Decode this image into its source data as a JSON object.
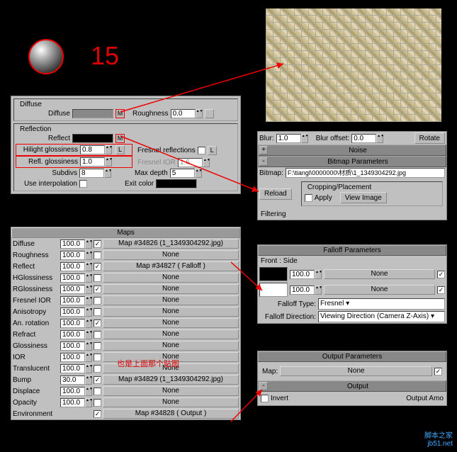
{
  "number": "15",
  "diffuse_panel": {
    "title": "Diffuse",
    "diffuse_lbl": "Diffuse",
    "roughness_lbl": "Roughness",
    "roughness_val": "0.0",
    "m": "M"
  },
  "reflection_panel": {
    "title": "Reflection",
    "reflect_lbl": "Reflect",
    "m": "M",
    "hilight_lbl": "Hilight glossiness",
    "hilight_val": "0.8",
    "l": "L",
    "refl_gloss_lbl": "Refl. glossiness",
    "refl_gloss_val": "1.0",
    "fresnel_refl_lbl": "Fresnel reflections",
    "fresnel_ior_lbl": "Fresnel IOR",
    "fresnel_ior_val": "1.6",
    "subdivs_lbl": "Subdivs",
    "subdivs_val": "8",
    "maxdepth_lbl": "Max depth",
    "maxdepth_val": "5",
    "interp_lbl": "Use interpolation",
    "exit_lbl": "Exit color"
  },
  "maps": {
    "title": "Maps",
    "rows": [
      {
        "label": "Diffuse",
        "amt": "100.0",
        "chk": true,
        "slot": "Map #34826 (1_1349304292.jpg)",
        "red": true
      },
      {
        "label": "Roughness",
        "amt": "100.0",
        "chk": false,
        "slot": "None"
      },
      {
        "label": "Reflect",
        "amt": "100.0",
        "chk": true,
        "slot": "Map #34827  ( Falloff )",
        "red": true
      },
      {
        "label": "HGlossiness",
        "amt": "100.0",
        "chk": false,
        "slot": "None"
      },
      {
        "label": "RGlossiness",
        "amt": "100.0",
        "chk": true,
        "slot": "None"
      },
      {
        "label": "Fresnel IOR",
        "amt": "100.0",
        "chk": false,
        "slot": "None"
      },
      {
        "label": "Anisotropy",
        "amt": "100.0",
        "chk": false,
        "slot": "None"
      },
      {
        "label": "An. rotation",
        "amt": "100.0",
        "chk": true,
        "slot": "None"
      },
      {
        "label": "Refract",
        "amt": "100.0",
        "chk": false,
        "slot": "None"
      },
      {
        "label": "Glossiness",
        "amt": "100.0",
        "chk": false,
        "slot": "None"
      },
      {
        "label": "IOR",
        "amt": "100.0",
        "chk": false,
        "slot": "None"
      },
      {
        "label": "Translucent",
        "amt": "100.0",
        "chk": false,
        "slot": "None"
      },
      {
        "label": "Bump",
        "amt": "30.0",
        "chk": true,
        "slot": "Map #34829 (1_1349304292.jpg)",
        "red": true
      },
      {
        "label": "Displace",
        "amt": "100.0",
        "chk": false,
        "slot": "None"
      },
      {
        "label": "Opacity",
        "amt": "100.0",
        "chk": false,
        "slot": "None"
      },
      {
        "label": "Environment",
        "amt": "",
        "chk": true,
        "slot": "Map #34828  ( Output )",
        "red": true
      }
    ]
  },
  "annotation_ior": "也是上面那个贴图",
  "bitmap": {
    "blur_lbl": "Blur:",
    "blur_val": "1.0",
    "blur_off_lbl": "Blur offset:",
    "blur_off_val": "0.0",
    "rotate": "Rotate",
    "noise": "Noise",
    "params_title": "Bitmap Parameters",
    "bitmap_lbl": "Bitmap:",
    "bitmap_path": "F:\\tiangl\\0000000\\材质\\1_1349304292.jpg",
    "reload": "Reload",
    "crop_title": "Cropping/Placement",
    "apply": "Apply",
    "view": "View Image",
    "filtering": "Filtering"
  },
  "falloff": {
    "title": "Falloff Parameters",
    "front": "Front : Side",
    "amt1": "100.0",
    "amt2": "100.0",
    "slot": "None",
    "type_lbl": "Falloff Type:",
    "type_val": "Fresnel",
    "dir_lbl": "Falloff Direction:",
    "dir_val": "Viewing Direction (Camera Z-Axis)"
  },
  "output": {
    "title": "Output Parameters",
    "map_lbl": "Map:",
    "map_slot": "None",
    "out_title": "Output",
    "invert": "Invert",
    "out_amt": "Output Amo"
  },
  "watermark": {
    "l1": "脚本之家",
    "l2": "jb51.net"
  }
}
